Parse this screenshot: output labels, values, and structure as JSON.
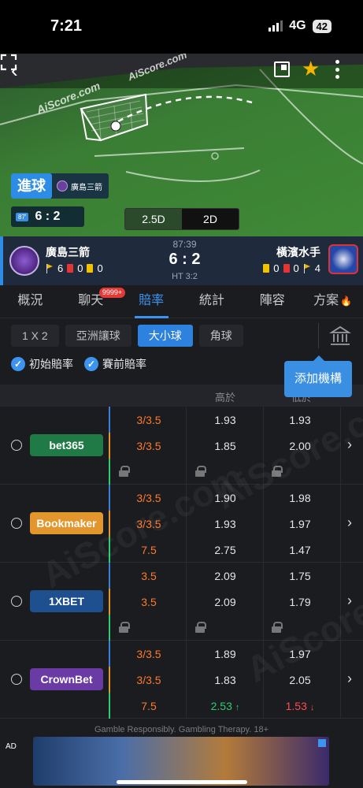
{
  "status_bar": {
    "time": "7:21",
    "network": "4G",
    "battery": "42"
  },
  "pitch": {
    "watermark": "AiScore.com",
    "goal_label": "進球",
    "goal_team": "廣島三箭",
    "minute_chip": "87'",
    "mini_score": "6 : 2",
    "view_options": [
      "2.5D",
      "2D"
    ]
  },
  "match": {
    "home_team": "廣島三箭",
    "away_team": "橫濱水手",
    "time": "87:39",
    "score": "6 : 2",
    "half_time": "HT 3:2",
    "home_stats": {
      "corners": "6",
      "red": "0",
      "yellow": "0"
    },
    "away_stats": {
      "yellow": "0",
      "red": "0",
      "corners": "4"
    }
  },
  "tabs": [
    {
      "label": "概況"
    },
    {
      "label": "聊天",
      "badge": "9999+"
    },
    {
      "label": "賠率"
    },
    {
      "label": "統計"
    },
    {
      "label": "陣容"
    },
    {
      "label": "方案"
    }
  ],
  "markets": [
    "1 X 2",
    "亞洲讓球",
    "大小球",
    "角球"
  ],
  "filters": {
    "initial": "初始賠率",
    "pre_match": "賽前賠率",
    "add_org": "添加機構"
  },
  "table_head": {
    "over": "高於",
    "under": "低於"
  },
  "books": [
    {
      "name": "bet365",
      "bg": "#1f7a45",
      "rows": [
        {
          "line": "3/3.5",
          "over": "1.93",
          "under": "1.93"
        },
        {
          "line": "3/3.5",
          "over": "1.85",
          "under": "2.00"
        },
        {
          "locked": true
        }
      ]
    },
    {
      "name": "Bookmaker",
      "bg": "#e2962b",
      "rows": [
        {
          "line": "3/3.5",
          "over": "1.90",
          "under": "1.98"
        },
        {
          "line": "3/3.5",
          "over": "1.93",
          "under": "1.97"
        },
        {
          "line": "7.5",
          "over": "2.75",
          "under": "1.47"
        }
      ]
    },
    {
      "name": "1XBET",
      "bg": "#1e4f8f",
      "rows": [
        {
          "line": "3.5",
          "over": "2.09",
          "under": "1.75"
        },
        {
          "line": "3.5",
          "over": "2.09",
          "under": "1.79"
        },
        {
          "locked": true
        }
      ]
    },
    {
      "name": "CrownBet",
      "bg": "#6a3aa5",
      "rows": [
        {
          "line": "3/3.5",
          "over": "1.89",
          "under": "1.97"
        },
        {
          "line": "3/3.5",
          "over": "1.83",
          "under": "2.05"
        },
        {
          "line": "7.5",
          "over": "2.53",
          "under": "1.53",
          "over_trend": "up",
          "under_trend": "down"
        }
      ]
    }
  ],
  "footer": {
    "gamble_text": "Gamble Responsibly. Gambling Therapy. 18+",
    "ad_label": "AD"
  },
  "colors": {
    "accent": "#3b94f0",
    "line_orange": "#ff7a2a"
  }
}
